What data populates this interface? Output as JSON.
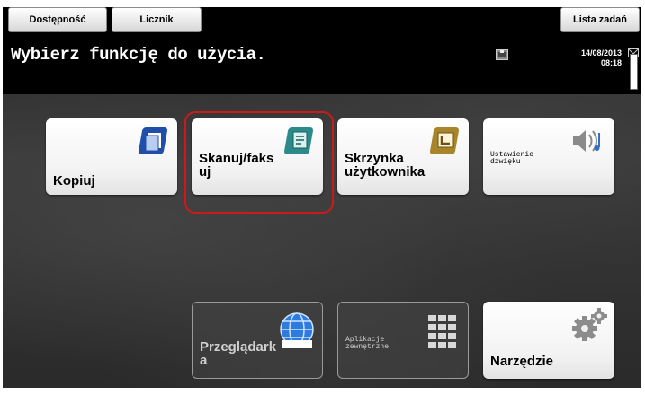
{
  "header": {
    "accessibility_label": "Dostępność",
    "counter_label": "Licznik",
    "job_list_label": "Lista zadań",
    "title": "Wybierz funkcję do użycia.",
    "date": "14/08/2013",
    "time": "08:18"
  },
  "tiles": {
    "copy": "Kopiuj",
    "scan_fax_1": "Skanuj/faks",
    "scan_fax_2": "uj",
    "user_box_1": "Skrzynka",
    "user_box_2": "użytkownika",
    "sound_1": "Ustawienie",
    "sound_2": "dźwięku",
    "browser_1": "Przeglądark",
    "browser_2": "a",
    "ext_apps_1": "Aplikacje",
    "ext_apps_2": "zewnętrzne",
    "utility": "Narzędzie"
  },
  "colors": {
    "accent_blue": "#1f4fa8",
    "accent_teal": "#2d8a8a",
    "accent_gold": "#a8842a",
    "highlight_red": "#cc1a1a"
  },
  "icons": {
    "copy": "copy-icon",
    "scan_fax": "scan-fax-icon",
    "user_box": "user-box-icon",
    "sound": "speaker-icon",
    "browser": "globe-icon",
    "ext_apps": "grid-icon",
    "utility": "gear-icon",
    "status": "printer-status-icon"
  }
}
